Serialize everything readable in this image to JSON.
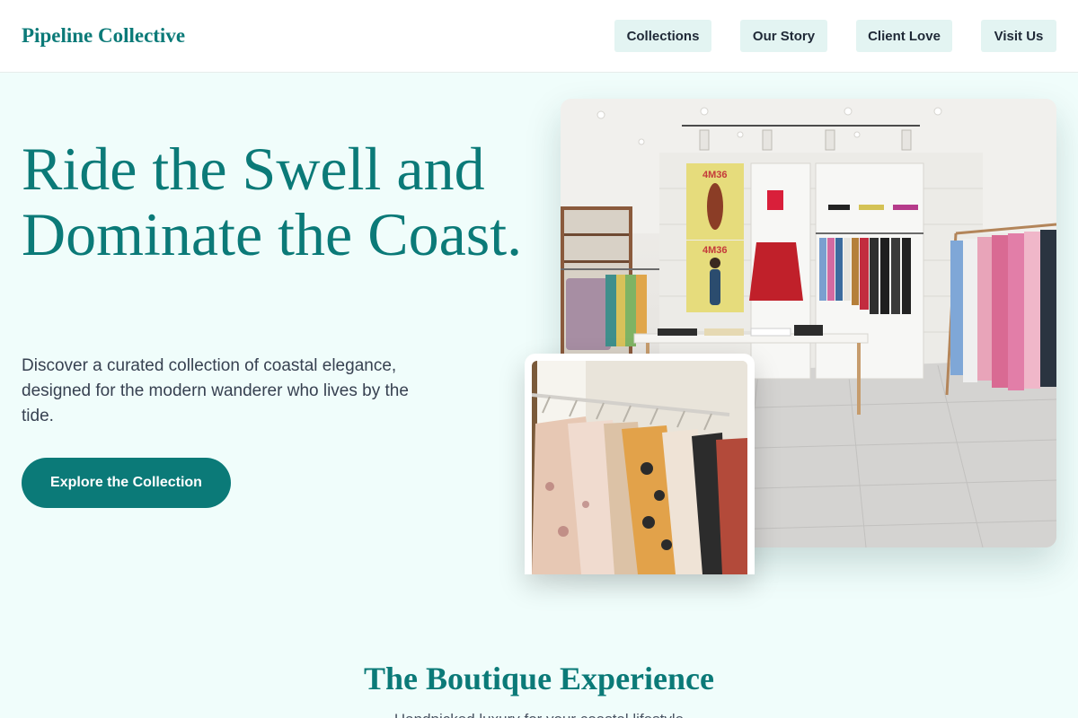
{
  "header": {
    "brand": "Pipeline Collective",
    "nav": [
      {
        "label": "Collections"
      },
      {
        "label": "Our Story"
      },
      {
        "label": "Client Love"
      },
      {
        "label": "Visit Us"
      }
    ]
  },
  "hero": {
    "title": "Ride the Swell and Dominate the Coast.",
    "copy": "Discover a curated collection of coastal elegance, designed for the modern wanderer who lives by the tide.",
    "cta_label": "Explore the Collection",
    "store_poster_text_1": "4M36",
    "store_poster_text_2": "4M36"
  },
  "section": {
    "title": "The Boutique Experience",
    "subtitle": "Handpicked luxury for your coastal lifestyle"
  },
  "colors": {
    "accent": "#0b7a78",
    "page_bg": "#f0fdfb",
    "nav_button_bg": "#e3f4f2"
  }
}
